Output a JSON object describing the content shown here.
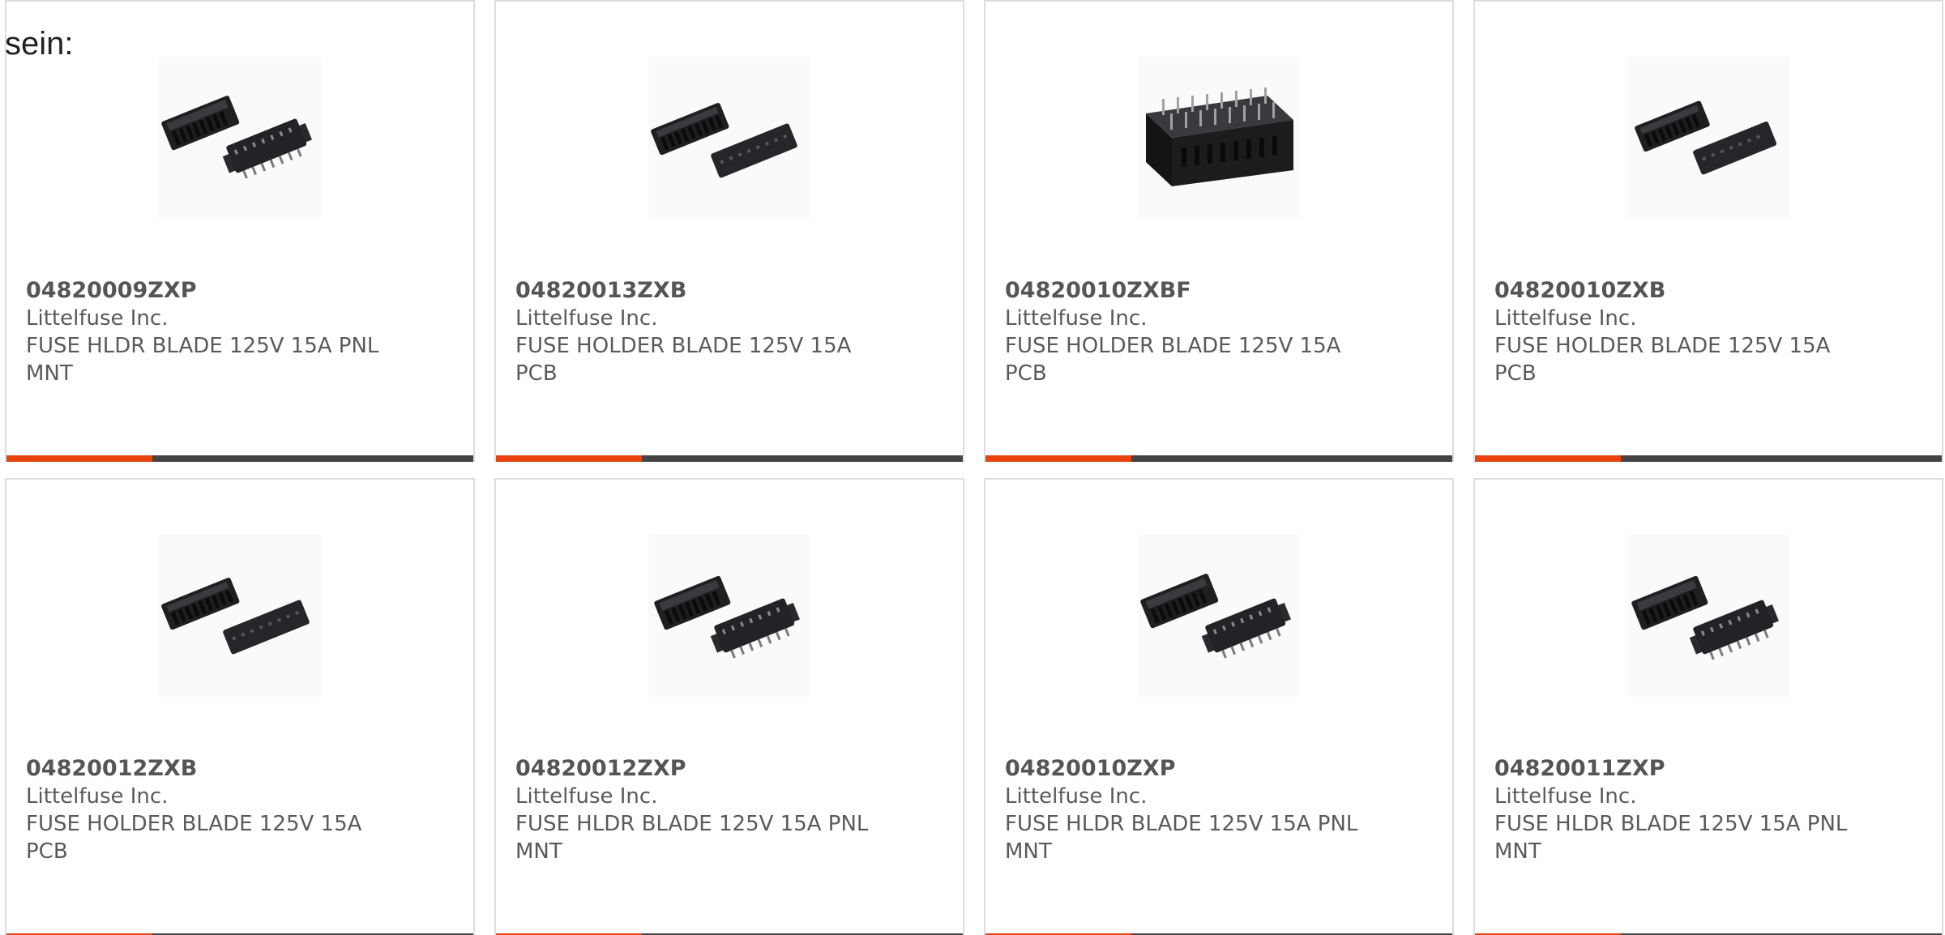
{
  "intro_text": "sein:",
  "colors": {
    "accent": "#e8420f",
    "bar": "#444444",
    "border": "#dddddd"
  },
  "products": [
    {
      "part_number": "04820009ZXP",
      "manufacturer": "Littelfuse Inc.",
      "description": "FUSE HLDR BLADE 125V 15A PNL MNT",
      "image": "fuse-holder-pair-panel-mount"
    },
    {
      "part_number": "04820013ZXB",
      "manufacturer": "Littelfuse Inc.",
      "description": "FUSE HOLDER BLADE 125V 15A PCB",
      "image": "fuse-holder-pair-pcb"
    },
    {
      "part_number": "04820010ZXBF",
      "manufacturer": "Littelfuse Inc.",
      "description": "FUSE HOLDER BLADE 125V 15A PCB",
      "image": "fuse-holder-block-pcb"
    },
    {
      "part_number": "04820010ZXB",
      "manufacturer": "Littelfuse Inc.",
      "description": "FUSE HOLDER BLADE 125V 15A PCB",
      "image": "fuse-holder-pair-pcb"
    },
    {
      "part_number": "04820012ZXB",
      "manufacturer": "Littelfuse Inc.",
      "description": "FUSE HOLDER BLADE 125V 15A PCB",
      "image": "fuse-holder-pair-pcb"
    },
    {
      "part_number": "04820012ZXP",
      "manufacturer": "Littelfuse Inc.",
      "description": "FUSE HLDR BLADE 125V 15A PNL MNT",
      "image": "fuse-holder-pair-panel-mount"
    },
    {
      "part_number": "04820010ZXP",
      "manufacturer": "Littelfuse Inc.",
      "description": "FUSE HLDR BLADE 125V 15A PNL MNT",
      "image": "fuse-holder-pair-panel-mount"
    },
    {
      "part_number": "04820011ZXP",
      "manufacturer": "Littelfuse Inc.",
      "description": "FUSE HLDR BLADE 125V 15A PNL MNT",
      "image": "fuse-holder-pair-panel-mount"
    }
  ]
}
